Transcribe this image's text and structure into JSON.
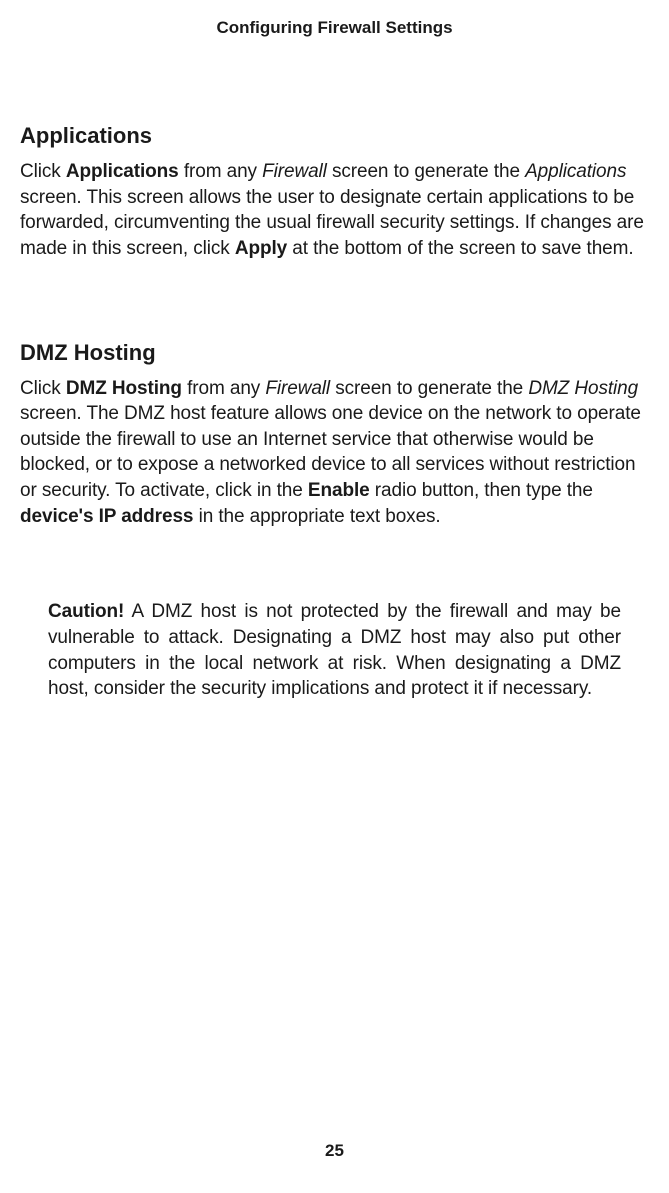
{
  "header": {
    "title": "Configuring Firewall Settings"
  },
  "sections": {
    "applications": {
      "heading": "Applications",
      "p1_1": "Click ",
      "p1_b1": "Applications",
      "p1_2": " from any ",
      "p1_i1": "Firewall",
      "p1_3": " screen to generate the ",
      "p1_i2": "Applications",
      "p1_4": " screen. This screen allows the user to designate certain applications to be forwarded, circumventing the usual firewall security settings. If changes are made in this screen, click ",
      "p1_b2": "Apply",
      "p1_5": " at the bottom of the screen to save them."
    },
    "dmz": {
      "heading": "DMZ Hosting",
      "p1_1": "Click ",
      "p1_b1": "DMZ Hosting",
      "p1_2": " from any ",
      "p1_i1": "Firewall",
      "p1_3": " screen to generate the ",
      "p1_i2": "DMZ Hosting",
      "p1_4": " screen. The DMZ host feature allows one device on the network to operate outside the firewall to use an Internet service that otherwise would be blocked, or to expose a networked device to all services without restriction or security. To activate, click in the ",
      "p1_b2": "Enable",
      "p1_5": " radio button, then type the ",
      "p1_b3": "device's IP address",
      "p1_6": " in the appropriate text boxes."
    },
    "caution": {
      "label": "Caution!",
      "text": " A DMZ host is not protected by the firewall and may be vulnerable to attack. Designating a DMZ host may also put other computers in the local network at risk. When designating a DMZ host, consider the security implications and protect it if necessary."
    }
  },
  "page_number": "25"
}
